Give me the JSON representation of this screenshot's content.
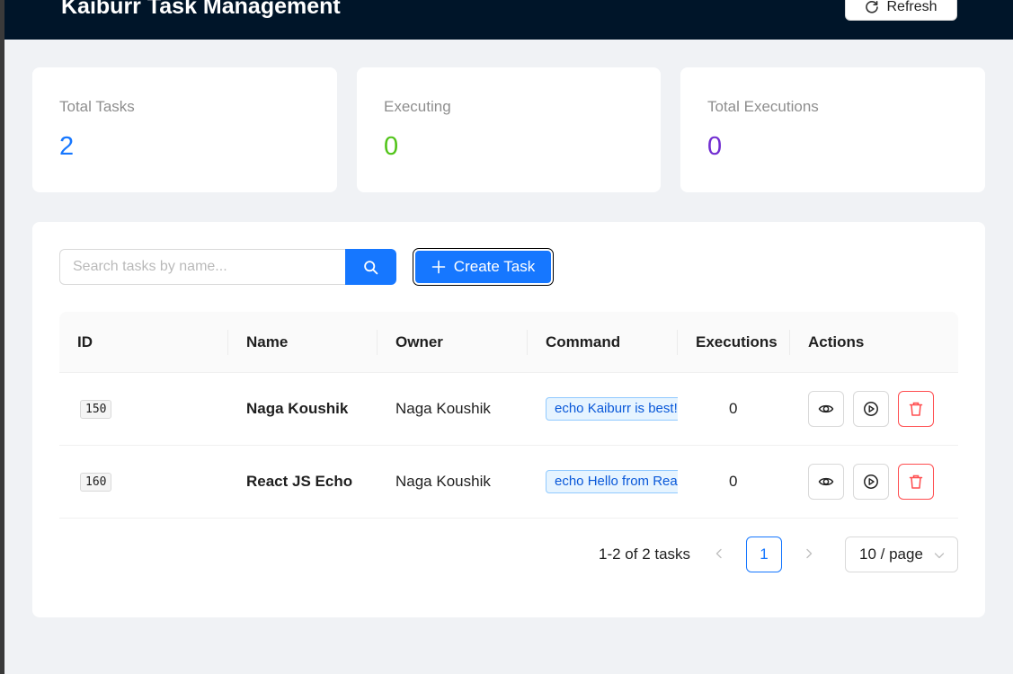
{
  "header": {
    "title": "Kaiburr Task Management",
    "refresh_label": "Refresh"
  },
  "stats": {
    "total_tasks": {
      "label": "Total Tasks",
      "value": "2",
      "color": "#1677ff"
    },
    "executing": {
      "label": "Executing",
      "value": "0",
      "color": "#52c41a"
    },
    "total_executions": {
      "label": "Total Executions",
      "value": "0",
      "color": "#722ed1"
    }
  },
  "toolbar": {
    "search_placeholder": "Search tasks by name...",
    "search_value": "",
    "create_label": "Create Task",
    "primary_color": "#1677ff"
  },
  "table": {
    "columns": [
      "ID",
      "Name",
      "Owner",
      "Command",
      "Executions",
      "Actions"
    ],
    "rows": [
      {
        "id": "150",
        "name": "Naga Koushik",
        "owner": "Naga Koushik",
        "command": "echo Kaiburr is best!",
        "executions": "0"
      },
      {
        "id": "160",
        "name": "React JS Echo",
        "owner": "Naga Koushik",
        "command": "echo Hello from React",
        "executions": "0"
      }
    ],
    "action_icons": [
      "eye-icon",
      "play-circle-icon",
      "delete-icon"
    ]
  },
  "pagination": {
    "total_text": "1-2 of 2 tasks",
    "current_page": "1",
    "page_size": "10 / page"
  }
}
